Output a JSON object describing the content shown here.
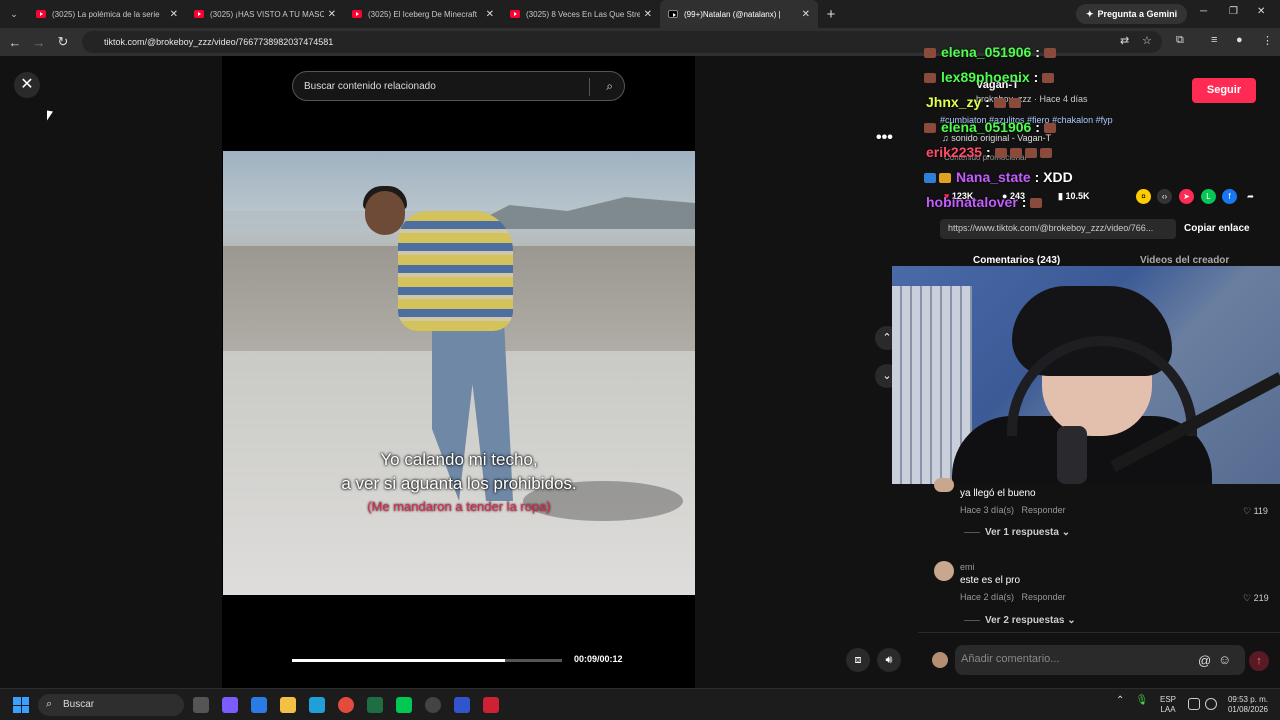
{
  "browser": {
    "tabs": [
      {
        "title": "(3025) La polémica de la serie",
        "active": false
      },
      {
        "title": "(3025) ¡HAS VISTO A TU MASC",
        "active": false
      },
      {
        "title": "(3025) El Iceberg De Minecraft",
        "active": false
      },
      {
        "title": "(3025) 8 Veces En Las Que Stre",
        "active": false
      },
      {
        "title": "(99+)Natalan (@natalanx) |",
        "active": true
      }
    ],
    "gemini_label": "Pregunta a Gemini",
    "url": "tiktok.com/@brokeboy_zzz/video/7667738982037474581"
  },
  "video": {
    "search_placeholder": "Buscar contenido relacionado",
    "subtitle_line1": "Yo calando mi techo,",
    "subtitle_line2": "a ver si aguanta los prohibidos.",
    "subtitle_note": "(Me mandaron a tender la ropa)",
    "progress": 0.79,
    "time": "00:09/00:12"
  },
  "creator": {
    "name": "Vagan-T",
    "meta": "brokeboy_zzz · Hace 4 días",
    "follow_label": "Seguir",
    "description": "#cumbiaton #azulitos #fiero #chakalon #fyp",
    "sound": "♫ sonido original - Vagan-T",
    "promo": "Contenido promocional"
  },
  "stats": {
    "likes": "123K",
    "comments": "243",
    "saves": "10.5K"
  },
  "link": {
    "text": "https://www.tiktok.com/@brokeboy_zzz/video/766...",
    "copy_label": "Copiar enlace"
  },
  "panel_tabs": {
    "comments": "Comentarios (243)",
    "creator_videos": "Videos del creador"
  },
  "stream_chat": [
    {
      "user": "elena_051906",
      "msg": ":",
      "color": "#4dff4d"
    },
    {
      "user": "lex89phoenix",
      "msg": ":",
      "color": "#4dff4d"
    },
    {
      "user": "Jhnx_zy",
      "msg": ":",
      "color": "#e0ff4d"
    },
    {
      "user": "elena_051906",
      "msg": ":",
      "color": "#4dff4d"
    },
    {
      "user": "erik2235",
      "msg": ":",
      "color": "#ff4d6a"
    },
    {
      "user": "Nana_state",
      "msg": ": XDD",
      "color": "#c45cff"
    },
    {
      "user": "hobinatalover",
      "msg": ":",
      "color": "#c45cff"
    }
  ],
  "comments": [
    {
      "author": "",
      "text": "ya llegó el bueno",
      "time": "Hace 3 día(s)",
      "reply": "Responder",
      "likes": "119",
      "replies": "Ver 1 respuesta"
    },
    {
      "author": "emi",
      "text": "este es el pro",
      "time": "Hace 2 día(s)",
      "reply": "Responder",
      "likes": "219",
      "replies": "Ver 2 respuestas"
    }
  ],
  "comment_input": {
    "placeholder": "Añadir comentario..."
  },
  "taskbar": {
    "search": "Buscar",
    "lang1": "ESP",
    "lang2": "LAA",
    "time": "09:53 p. m.",
    "date": "01/08/2026"
  },
  "colors": {
    "accent": "#fe2c55",
    "background": "#121212"
  }
}
